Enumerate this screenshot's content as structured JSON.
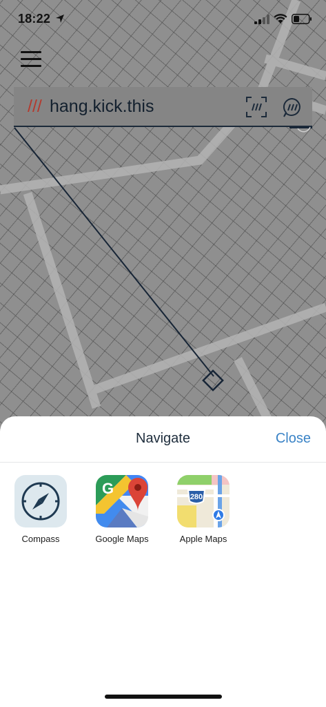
{
  "status_bar": {
    "time": "18:22"
  },
  "address": {
    "prefix": "///",
    "words": "hang.kick.this"
  },
  "sheet": {
    "title": "Navigate",
    "close_label": "Close",
    "apps": [
      {
        "label": "Compass",
        "icon": "compass-icon"
      },
      {
        "label": "Google Maps",
        "icon": "google-maps-icon"
      },
      {
        "label": "Apple Maps",
        "icon": "apple-maps-icon"
      }
    ]
  },
  "colors": {
    "accent": "#3a83c6",
    "slashes": "#b43a2e",
    "text_dark": "#1e2d3c",
    "map_overlay": "#8f8f8f"
  }
}
